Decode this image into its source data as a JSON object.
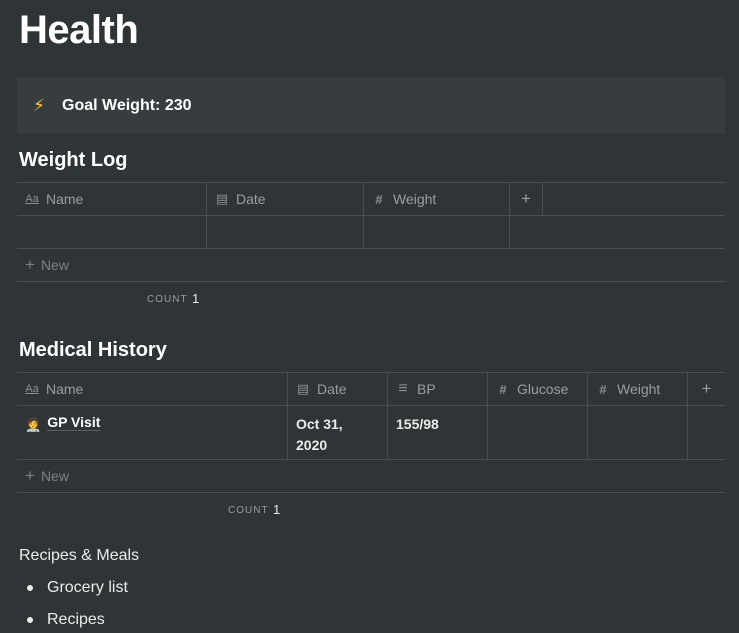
{
  "page": {
    "title": "Health"
  },
  "callout": {
    "icon": "lightning-icon",
    "glyph": "⚡",
    "text": "Goal Weight: 230"
  },
  "weight_log": {
    "title": "Weight Log",
    "columns": [
      {
        "label": "Name",
        "icon": "title-icon",
        "glyph": "Aa"
      },
      {
        "label": "Date",
        "icon": "calendar-icon",
        "glyph": "▤"
      },
      {
        "label": "Weight",
        "icon": "number-icon",
        "glyph": "#"
      }
    ],
    "add_column_glyph": "+",
    "new_label": "New",
    "count_label": "COUNT",
    "count_value": "1"
  },
  "medical_history": {
    "title": "Medical History",
    "columns": [
      {
        "label": "Name",
        "icon": "title-icon",
        "glyph": "Aa"
      },
      {
        "label": "Date",
        "icon": "calendar-icon",
        "glyph": "▤"
      },
      {
        "label": "BP",
        "icon": "text-icon",
        "glyph": "≡"
      },
      {
        "label": "Glucose",
        "icon": "number-icon",
        "glyph": "#"
      },
      {
        "label": "Weight",
        "icon": "number-icon",
        "glyph": "#"
      }
    ],
    "rows": [
      {
        "icon": "doctor-icon",
        "glyph": "🧑‍⚕️",
        "name": "GP Visit",
        "date_line1": "Oct 31,",
        "date_line2": "2020",
        "bp": "155/98",
        "glucose": "",
        "weight": ""
      }
    ],
    "add_column_glyph": "+",
    "new_label": "New",
    "count_label": "COUNT",
    "count_value": "1"
  },
  "recipes": {
    "heading": "Recipes & Meals",
    "items": [
      {
        "label": "Grocery list"
      },
      {
        "label": "Recipes"
      }
    ]
  }
}
